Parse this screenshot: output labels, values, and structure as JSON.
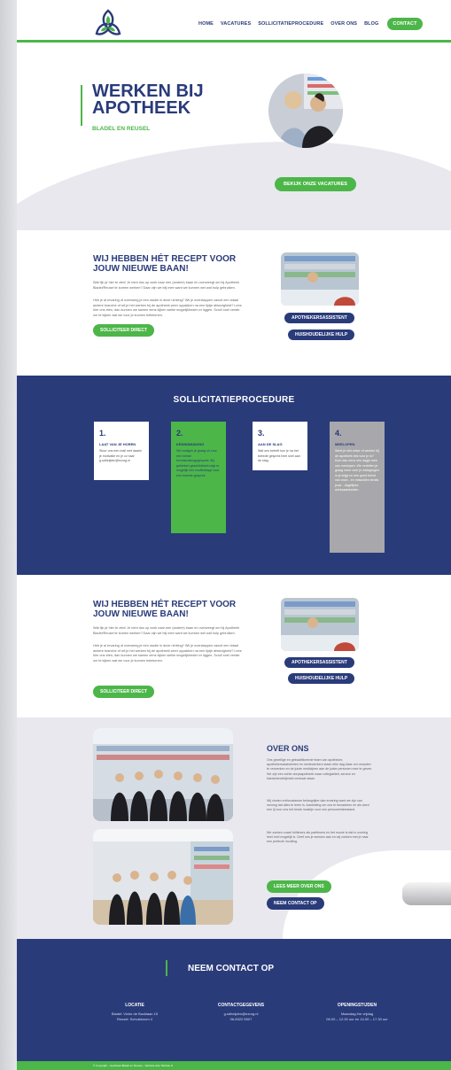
{
  "nav": {
    "items": [
      "HOME",
      "VACATURES",
      "SOLLICITATIEPROCEDURE",
      "OVER ONS",
      "BLOG"
    ],
    "contact": "CONTACT"
  },
  "hero": {
    "title": "WERKEN BIJ APOTHEEK",
    "subtitle": "BLADEL EN REUSEL",
    "button": "BEKIJK ONZE VACATURES"
  },
  "recept": {
    "title": "WIJ HEBBEN HÉT RECEPT VOOR JOUW NIEUWE BAAN!",
    "p1": "Wat fijn je hier te zien! Je bent dus op zoek naar een (andere) baan en overweegt om bij Apotheek Bladel/Reusel te komen werken? Daar zijn we blij mee want we kunnen wel wat hulp gebruiken.",
    "p2": "Heb je al ervaring of overweeg je een studie in deze richting? Wil je overstappen vanuit een totaal andere branche of wil je het werken bij de apotheek weer oppakken na een tijdje afwezigheid? Lees hier ons eten, dan kunnen we samen eens kijken welke mogelijkheden er liggen. Scroll snel verder om te kijken wat we voor je kunnen betekenen.",
    "cta": "SOLLICITEER DIRECT",
    "tag1": "APOTHEKERSASSISTENT",
    "tag2": "HUISHOUDELIJKE HULP"
  },
  "procedure": {
    "title": "SOLLICITATIEPROCEDURE",
    "cards": [
      {
        "num": "1.",
        "title": "LAAT VAN JE HOREN",
        "desc": "Stuur ons een mail met daarin je motivatie en je cv naar g.sdheijden@ezorg.nl"
      },
      {
        "num": "2.",
        "title": "KENNISMAKING",
        "desc": "We nodigen je graag uit voor een eerste kennismakingsgesprek. Bij gebleken geschiktheid volgt er mogelijk een snuffelstage voor een tweede gesprek."
      },
      {
        "num": "3.",
        "title": "AAN DE SLAG",
        "desc": "Wat ons betreft kun je na het tweede gesprek heel snel aan de slag."
      },
      {
        "num": "4.",
        "title": "MEELOPEN",
        "desc": "Weet je niet zeker of werken bij de apotheek iets voor je is? Kom dan eens een dagje mee ons meelopen. We vertellen je graag meer over je uitdagingen in je krijgt en een goed beeld van onze - en misschien straks jouw - dagelijkse werkzaamheden."
      }
    ]
  },
  "over": {
    "title": "OVER ONS",
    "p1": "Ons gezellige en gekwalificeerde team van apotheker, apothekersassistenten en medewerkers staan elke dag klaar om recepten te verwerken en de juiste medicijnen aan de juiste personen mee te geven. We zijn een echte dorpsapotheek waar collegialiteit, service en klantvriendelijkheid centraal staan.",
    "p2": "Wij vinden enthousiasme belangrijker dan ervaring want we zijn van mening dat alles te leren is. Aanleiding om ons te benaderen en als werd een lij voor ons het beste invalrijn voor ons personeelsbestand.",
    "p3": "We zoeken zowel fulltimers als parttimers en het mooie is dat in overleg heel veel mogelijk is. Geef ons je wensen aan en wij zoeken met je naar een perfecte invulling.",
    "btn1": "LEES MEER OVER ONS",
    "btn2": "NEEM CONTACT OP"
  },
  "footer": {
    "title": "NEEM CONTACT OP",
    "cols": [
      {
        "head": "LOCATIE",
        "l1": "Bladel: Victor de Bucklaan 15",
        "l2": "Reusel: Schuisboom 4"
      },
      {
        "head": "CONTACTGEGEVENS",
        "l1": "g.sdheijden@ezorg.nl",
        "l2": "06-8322 5507"
      },
      {
        "head": "OPENINGSTIJDEN",
        "l1": "Maandag t/m vrijdag",
        "l2": "08.00 – 12.00 uur en 14.00 – 17.30 uur"
      }
    ],
    "copyright": "© Copyright – Apotheek Bladel en Reusel – Website door Merkek.nl"
  },
  "colors": {
    "navy": "#2a3b7a",
    "green": "#4cb649",
    "light": "#e8e8ee"
  }
}
